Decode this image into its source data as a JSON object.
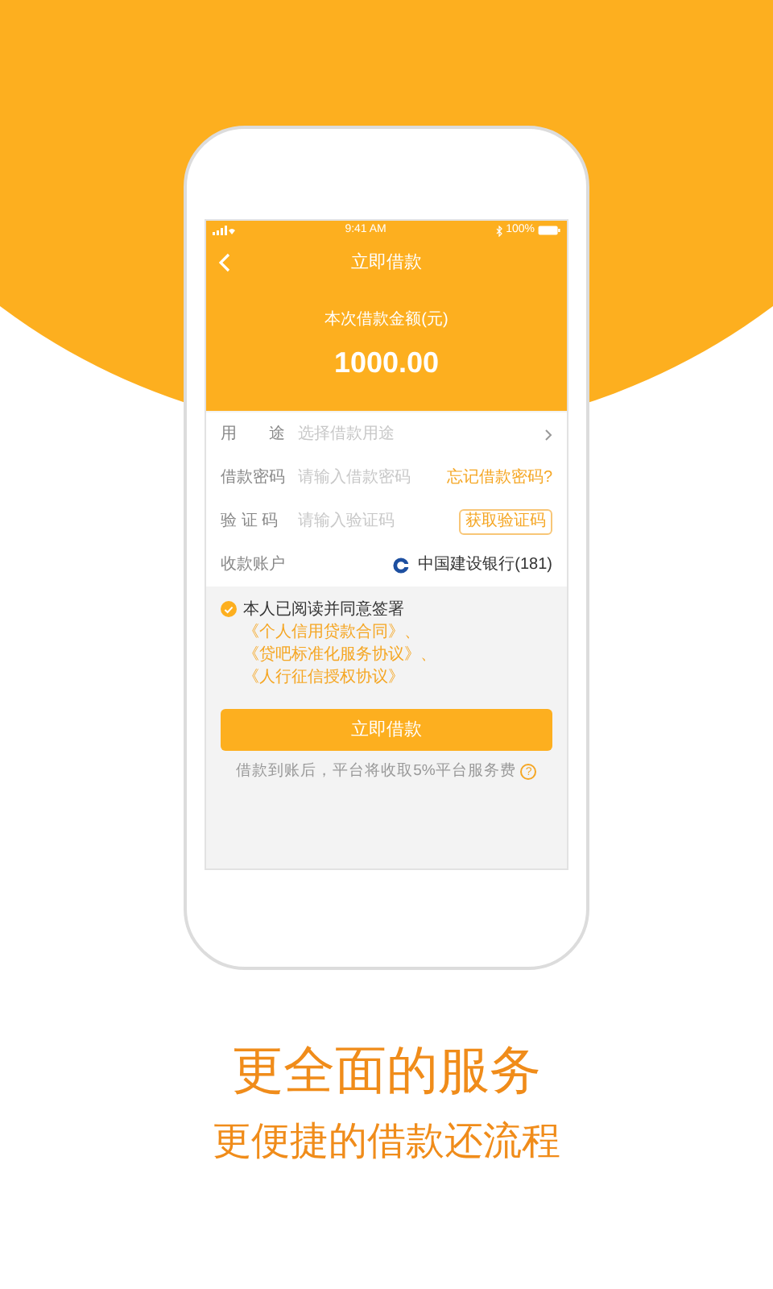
{
  "screen": {
    "status_bar": {
      "time": "9:41 AM",
      "battery": "100%"
    },
    "nav": {
      "title": "立即借款"
    },
    "amount": {
      "label": "本次借款金额(元)",
      "value": "1000.00"
    },
    "form_rows": [
      {
        "kind": "select",
        "label": "用　　途",
        "placeholder": "选择借款用途"
      },
      {
        "kind": "link",
        "label": "借款密码",
        "placeholder": "请输入借款密码",
        "action": "忘记借款密码?"
      },
      {
        "kind": "button",
        "label": "验 证 码",
        "placeholder": "请输入验证码",
        "action": "获取验证码"
      },
      {
        "kind": "account",
        "label": "收款账户",
        "value": "中国建设银行(181)"
      }
    ],
    "agreement": {
      "checked": true,
      "lead": "本人已阅读并同意签署",
      "links": [
        {
          "text": "《个人信用贷款合同》",
          "separator": "、"
        },
        {
          "text": "《贷吧标准化服务协议》",
          "separator": "、"
        },
        {
          "text": "《人行征信授权协议》"
        }
      ]
    },
    "submit_button": "立即借款",
    "fee_note": "借款到账后，平台将收取5%平台服务费",
    "help_icon": "?"
  },
  "taglines": [
    "更全面的服务",
    "更便捷的借款还流程"
  ]
}
